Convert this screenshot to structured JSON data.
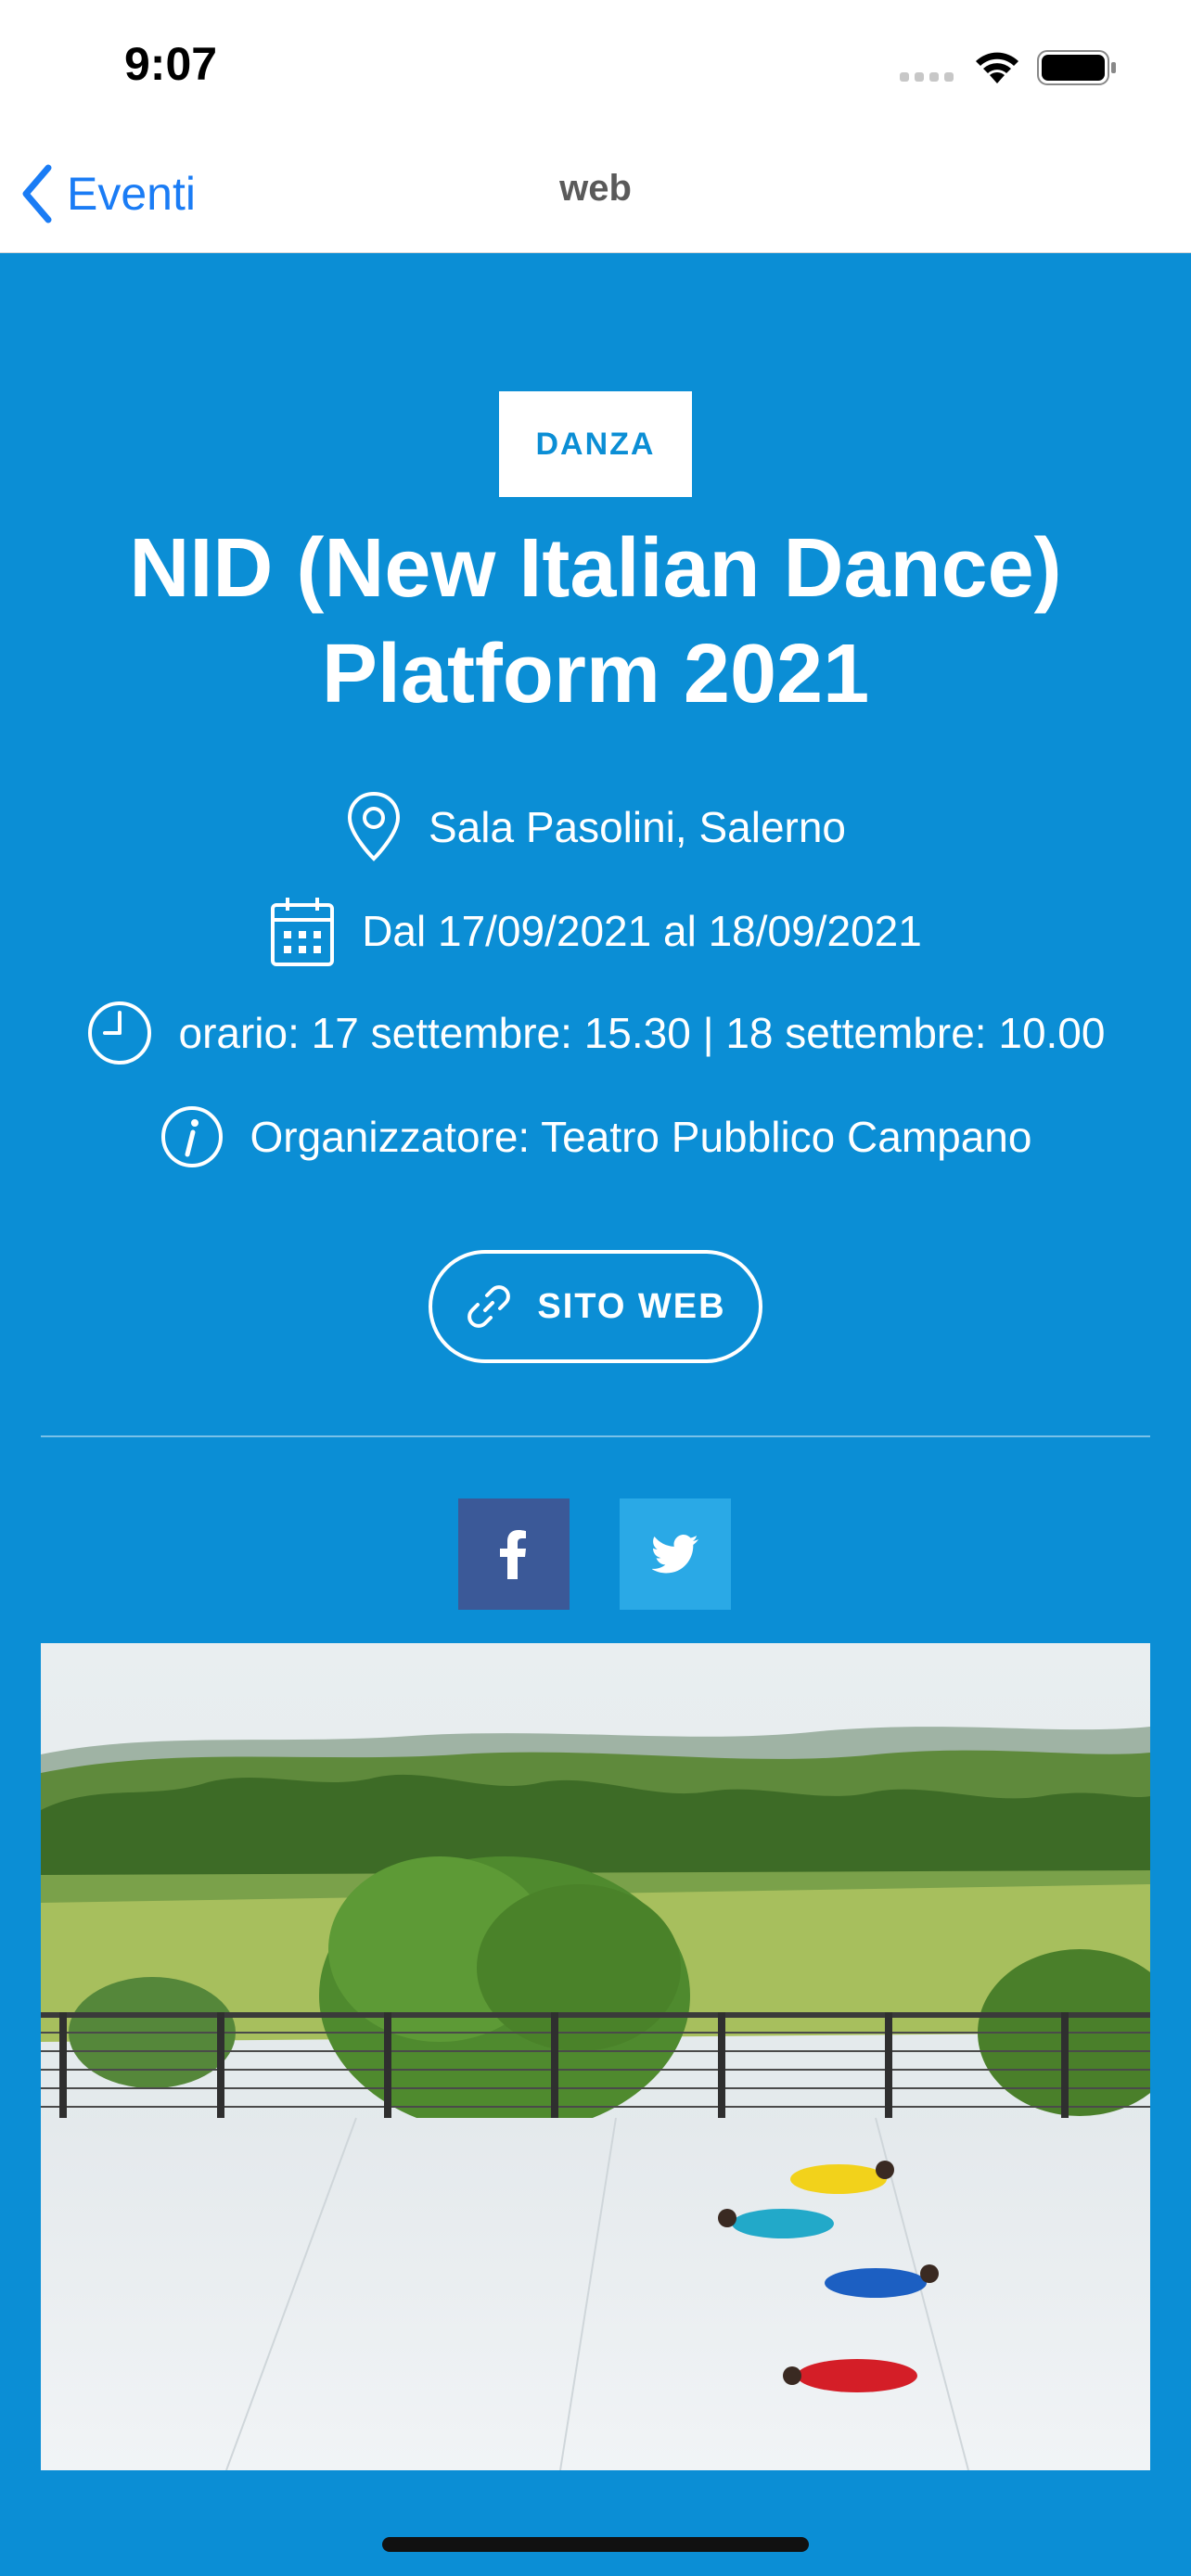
{
  "status_bar": {
    "time": "9:07"
  },
  "nav": {
    "back_label": "Eventi",
    "title": "web",
    "accent_color": "#1a7cf5"
  },
  "event": {
    "category": "DANZA",
    "title": "NID (New Italian Dance) Platform 2021",
    "location": "Sala Pasolini, Salerno",
    "dates": "Dal 17/09/2021 al 18/09/2021",
    "schedule": "orario: 17 settembre: 15.30 | 18 settembre: 10.00",
    "organizer": "Organizzatore: Teatro Pubblico Campano",
    "website_label": "SITO WEB",
    "background_color": "#0b8ed5"
  },
  "share": {
    "facebook_color": "#3b5998",
    "twitter_color": "#2aa9e6",
    "icons": [
      "facebook-icon",
      "twitter-icon"
    ]
  },
  "image": {
    "icon": "event-photo"
  }
}
